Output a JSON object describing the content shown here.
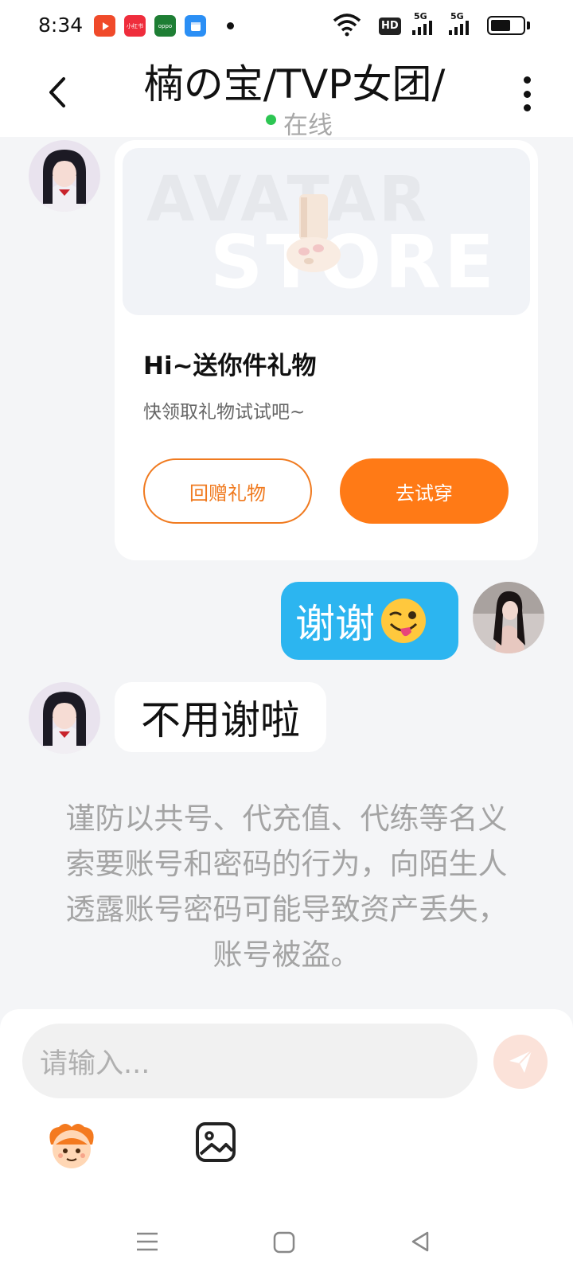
{
  "status_bar": {
    "time": "8:34",
    "apps": [
      {
        "icon": "video-app-icon",
        "label": "",
        "color": "#f04a2a"
      },
      {
        "icon": "news-app-icon",
        "label": "小红书",
        "color": "#ef2d3c"
      },
      {
        "icon": "oppo-app-icon",
        "label": "oppo",
        "color": "#1e7e34"
      },
      {
        "icon": "calendar-app-icon",
        "label": "",
        "color": "#2b8ff5"
      }
    ],
    "hd_label": "HD",
    "network1": "5G",
    "network2": "5G",
    "battery_level": 0.62
  },
  "header": {
    "title": "楠の宝/TVP女团/",
    "online_status": "在线",
    "online_color": "#2dc653"
  },
  "gift_card": {
    "banner_text_line1": "AVATAR",
    "banner_text_line2": "STORE",
    "title": "Hi~送你件礼物",
    "subtitle": "快领取礼物试试吧~",
    "return_gift_button": "回赠礼物",
    "try_on_button": "去试穿",
    "accent_color": "#ff7a16"
  },
  "messages": {
    "me_text": "谢谢",
    "me_emoji": "winking-tongue-emoji",
    "other_text": "不用谢啦"
  },
  "notice": "谨防以共号、代充值、代练等名义索要账号和密码的行为，向陌生人透露账号密码可能导致资产丢失，账号被盗。",
  "composer": {
    "placeholder": "请输入..."
  }
}
